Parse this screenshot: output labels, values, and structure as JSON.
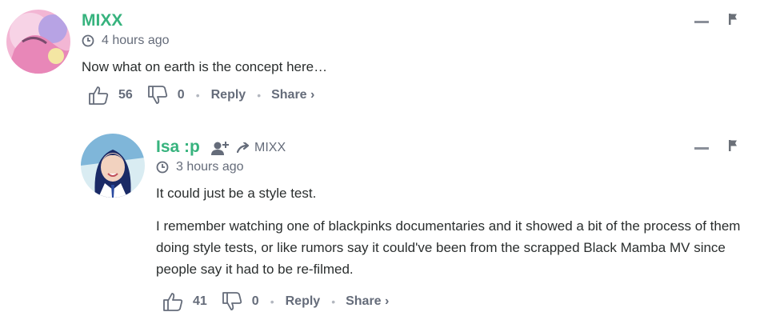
{
  "comments": [
    {
      "author": "MIXX",
      "time": "4 hours ago",
      "paragraphs": [
        "Now what on earth is the concept here…"
      ],
      "upvotes": "56",
      "downvotes": "0",
      "reply_label": "Reply",
      "share_label": "Share ›"
    },
    {
      "author": "Isa :p",
      "reply_to": "MIXX",
      "time": "3 hours ago",
      "paragraphs": [
        "It could just be a style test.",
        "I remember watching one of blackpinks documentaries and it showed a bit of the process of them doing style tests, or like rumors say it could've been from the scrapped Black Mamba MV since people say it had to be re-filmed."
      ],
      "upvotes": "41",
      "downvotes": "0",
      "reply_label": "Reply",
      "share_label": "Share ›"
    }
  ],
  "colors": {
    "author": "#37b37e",
    "meta": "#656c7a",
    "text": "#2a2e2e"
  },
  "icons": [
    "clock-icon",
    "thumbs-up-icon",
    "thumbs-down-icon",
    "collapse-icon",
    "flag-icon",
    "follow-user-icon",
    "reply-arrow-icon"
  ]
}
